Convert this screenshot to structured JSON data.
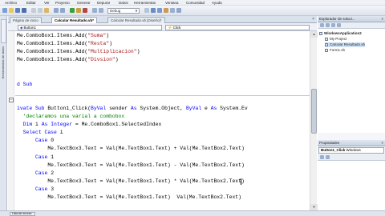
{
  "menu": [
    "Archivo",
    "Editar",
    "Ver",
    "Proyecto",
    "Generar",
    "Depurar",
    "Datos",
    "Herramientas",
    "Ventana",
    "Comunidad",
    "Ayuda"
  ],
  "toolbar": {
    "config_value": "Debug"
  },
  "doc_tabs": [
    {
      "label": "Página de inicio",
      "active": false
    },
    {
      "label": "Calcular Resultado.vb*",
      "active": true
    },
    {
      "label": "Calcular Resultado.vb [Diseño]*",
      "active": false
    }
  ],
  "nav": {
    "class_drop": "Button1",
    "method_drop": "Click"
  },
  "left_strip_label": "Herramientas de datos",
  "code_lines": [
    [
      {
        "t": "Me.ComboBox1.Items.Add(",
        "c": ""
      },
      {
        "t": "\"Suma\"",
        "c": "str"
      },
      {
        "t": ")",
        "c": ""
      }
    ],
    [
      {
        "t": "Me.ComboBox1.Items.Add(",
        "c": ""
      },
      {
        "t": "\"Resta\"",
        "c": "str"
      },
      {
        "t": ")",
        "c": ""
      }
    ],
    [
      {
        "t": "Me.ComboBox1.Items.Add(",
        "c": ""
      },
      {
        "t": "\"Multiplicacion\"",
        "c": "str"
      },
      {
        "t": ")",
        "c": ""
      }
    ],
    [
      {
        "t": "Me.ComboBox1.Items.Add(",
        "c": ""
      },
      {
        "t": "\"Divsion\"",
        "c": "str"
      },
      {
        "t": ")",
        "c": ""
      }
    ],
    [],
    [],
    [
      {
        "t": "d Sub",
        "c": "kw"
      }
    ],
    [],
    [],
    [
      {
        "t": "ivate Sub",
        "c": "kw"
      },
      {
        "t": " Button1_Click(",
        "c": ""
      },
      {
        "t": "ByVal",
        "c": "kw"
      },
      {
        "t": " sender ",
        "c": ""
      },
      {
        "t": "As",
        "c": "kw"
      },
      {
        "t": " System.Object, ",
        "c": ""
      },
      {
        "t": "ByVal",
        "c": "kw"
      },
      {
        "t": " e ",
        "c": ""
      },
      {
        "t": "As",
        "c": "kw"
      },
      {
        "t": " System.Ev",
        "c": ""
      }
    ],
    [
      {
        "t": "  'declaramos una varial a combobox",
        "c": "cm"
      }
    ],
    [
      {
        "t": "  Dim",
        "c": "kw"
      },
      {
        "t": " i ",
        "c": ""
      },
      {
        "t": "As Integer",
        "c": "kw"
      },
      {
        "t": " = Me.ComboBox1.SelectedIndex",
        "c": ""
      }
    ],
    [
      {
        "t": "  Select Case",
        "c": "kw"
      },
      {
        "t": " i",
        "c": ""
      }
    ],
    [
      {
        "t": "      Case",
        "c": "kw"
      },
      {
        "t": " 0",
        "c": ""
      }
    ],
    [
      {
        "t": "          Me.TextBox3.Text = Val(Me.TextBox1.Text) + Val(Me.TextBox2.Text)",
        "c": ""
      }
    ],
    [
      {
        "t": "      Case",
        "c": "kw"
      },
      {
        "t": " 1",
        "c": ""
      }
    ],
    [
      {
        "t": "          Me.TextBox3.Text = Val(Me.TextBox1.Text) - Val(Me.TextBox2.Text)",
        "c": ""
      }
    ],
    [
      {
        "t": "      Case",
        "c": "kw"
      },
      {
        "t": " 2",
        "c": ""
      }
    ],
    [
      {
        "t": "          Me.TextBox3.Text = Val(Me.TextBox1.Text) * Val(Me.TextBox2.Text)",
        "c": ""
      }
    ],
    [
      {
        "t": "      Case",
        "c": "kw"
      },
      {
        "t": " 3",
        "c": ""
      }
    ],
    [
      {
        "t": "          Me.TextBox3.Text = Val(Me.TextBox1.Text)  Val(Me.TextBox2.Text)",
        "c": ""
      }
    ]
  ],
  "solution_explorer": {
    "title": "Explorador de soluci...",
    "items": [
      {
        "label": "WindowsApplication2",
        "bold": true,
        "indent": 0
      },
      {
        "label": "My Project",
        "bold": false,
        "indent": 1
      },
      {
        "label": "Calcular Resultado.vb",
        "bold": false,
        "indent": 1,
        "selected": true
      },
      {
        "label": "Form1.vb",
        "bold": false,
        "indent": 1
      }
    ]
  },
  "properties": {
    "title": "Propiedades",
    "object_name": "Button1_Click",
    "object_type": "Windows"
  },
  "status": {
    "task_label": "Lista de errores"
  }
}
